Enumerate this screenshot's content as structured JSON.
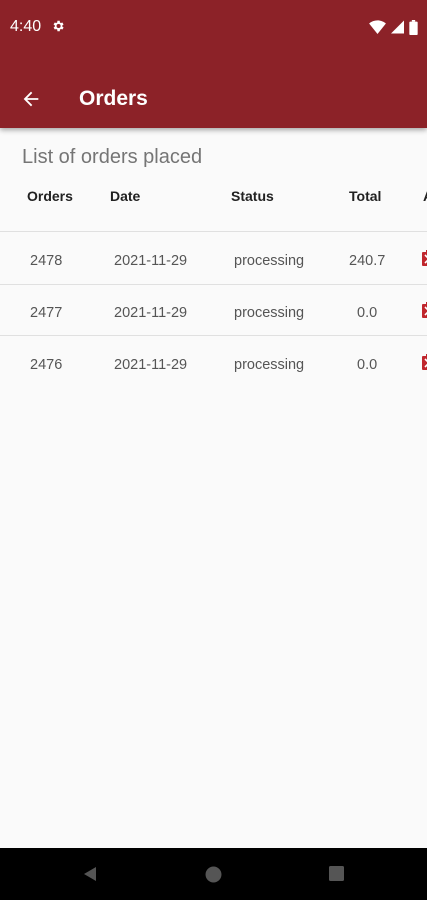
{
  "status_bar": {
    "time": "4:40",
    "icons": [
      "gear-icon",
      "wifi-icon",
      "cellular-icon",
      "battery-icon"
    ]
  },
  "toolbar": {
    "title": "Orders",
    "back_icon": "arrow-back-icon"
  },
  "page": {
    "subtitle": "List of orders placed"
  },
  "table": {
    "headers": {
      "orders": "Orders",
      "date": "Date",
      "status": "Status",
      "total": "Total",
      "action": "A"
    },
    "rows": [
      {
        "order": "2478",
        "date": "2021-11-29",
        "status": "processing",
        "total": "240.7",
        "action_icon": "delete-icon"
      },
      {
        "order": "2477",
        "date": "2021-11-29",
        "status": "processing",
        "total": "0.0",
        "action_icon": "delete-icon"
      },
      {
        "order": "2476",
        "date": "2021-11-29",
        "status": "processing",
        "total": "0.0",
        "action_icon": "delete-icon"
      }
    ]
  },
  "nav": {
    "back": "nav-back-icon",
    "home": "nav-home-icon",
    "recents": "nav-recents-icon"
  },
  "colors": {
    "app_bar": "#8c2228",
    "accent_icon": "#c0262d"
  }
}
